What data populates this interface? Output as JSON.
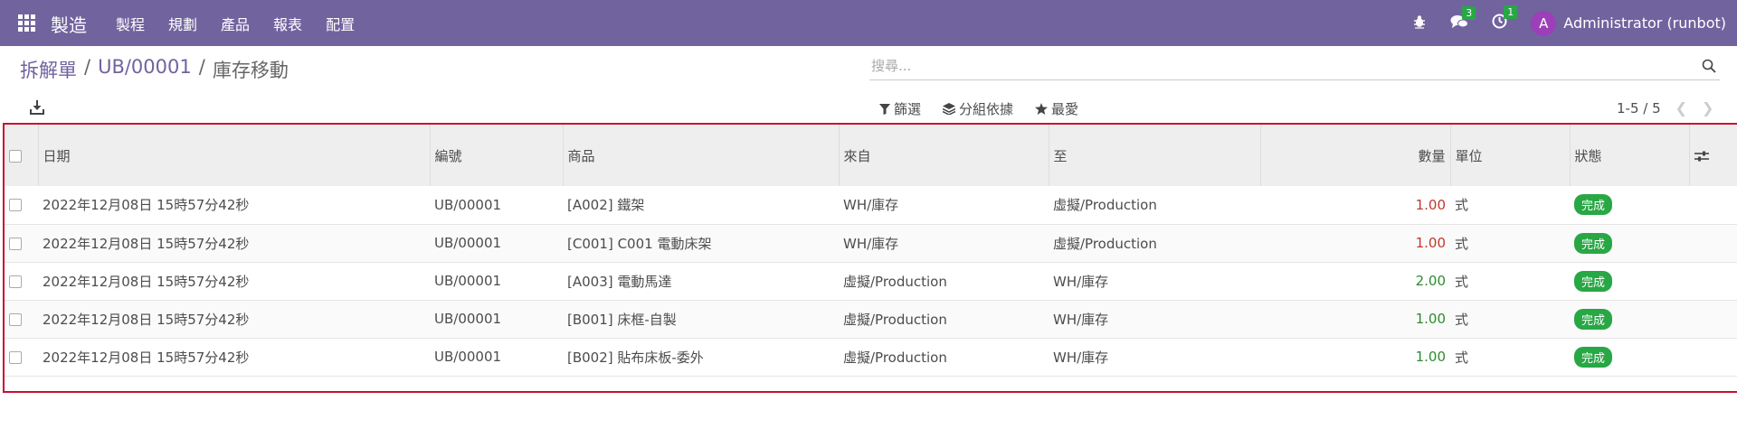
{
  "navbar": {
    "app_title": "製造",
    "menu": [
      "製程",
      "規劃",
      "產品",
      "報表",
      "配置"
    ],
    "messages_count": "3",
    "activities_count": "1",
    "avatar_letter": "A",
    "user_name": "Administrator (runbot)"
  },
  "breadcrumb": {
    "items": [
      "拆解單",
      "UB/00001"
    ],
    "current": "庫存移動"
  },
  "search": {
    "placeholder": "搜尋..."
  },
  "filters": {
    "filter_label": "篩選",
    "group_label": "分組依據",
    "favorites_label": "最愛"
  },
  "pager": {
    "value": "1-5 / 5"
  },
  "table": {
    "columns": [
      "日期",
      "編號",
      "商品",
      "來自",
      "至",
      "數量",
      "單位",
      "狀態"
    ],
    "rows": [
      {
        "date": "2022年12月08日 15時57分42秒",
        "ref": "UB/00001",
        "product": "[A002] 鐵架",
        "from": "WH/庫存",
        "to": "虛擬/Production",
        "qty": "1.00",
        "unit": "式",
        "status": "完成"
      },
      {
        "date": "2022年12月08日 15時57分42秒",
        "ref": "UB/00001",
        "product": "[C001] C001 電動床架",
        "from": "WH/庫存",
        "to": "虛擬/Production",
        "qty": "1.00",
        "unit": "式",
        "status": "完成"
      },
      {
        "date": "2022年12月08日 15時57分42秒",
        "ref": "UB/00001",
        "product": "[A003] 電動馬達",
        "from": "虛擬/Production",
        "to": "WH/庫存",
        "qty": "2.00",
        "unit": "式",
        "status": "完成"
      },
      {
        "date": "2022年12月08日 15時57分42秒",
        "ref": "UB/00001",
        "product": "[B001] 床框-自製",
        "from": "虛擬/Production",
        "to": "WH/庫存",
        "qty": "1.00",
        "unit": "式",
        "status": "完成"
      },
      {
        "date": "2022年12月08日 15時57分42秒",
        "ref": "UB/00001",
        "product": "[B002] 貼布床板-委外",
        "from": "虛擬/Production",
        "to": "WH/庫存",
        "qty": "1.00",
        "unit": "式",
        "status": "完成"
      }
    ]
  },
  "colors": {
    "navbar": "#71639e",
    "qty_out": "#c0392b",
    "qty_in": "#2e8b2e",
    "status_done": "#28a745"
  }
}
